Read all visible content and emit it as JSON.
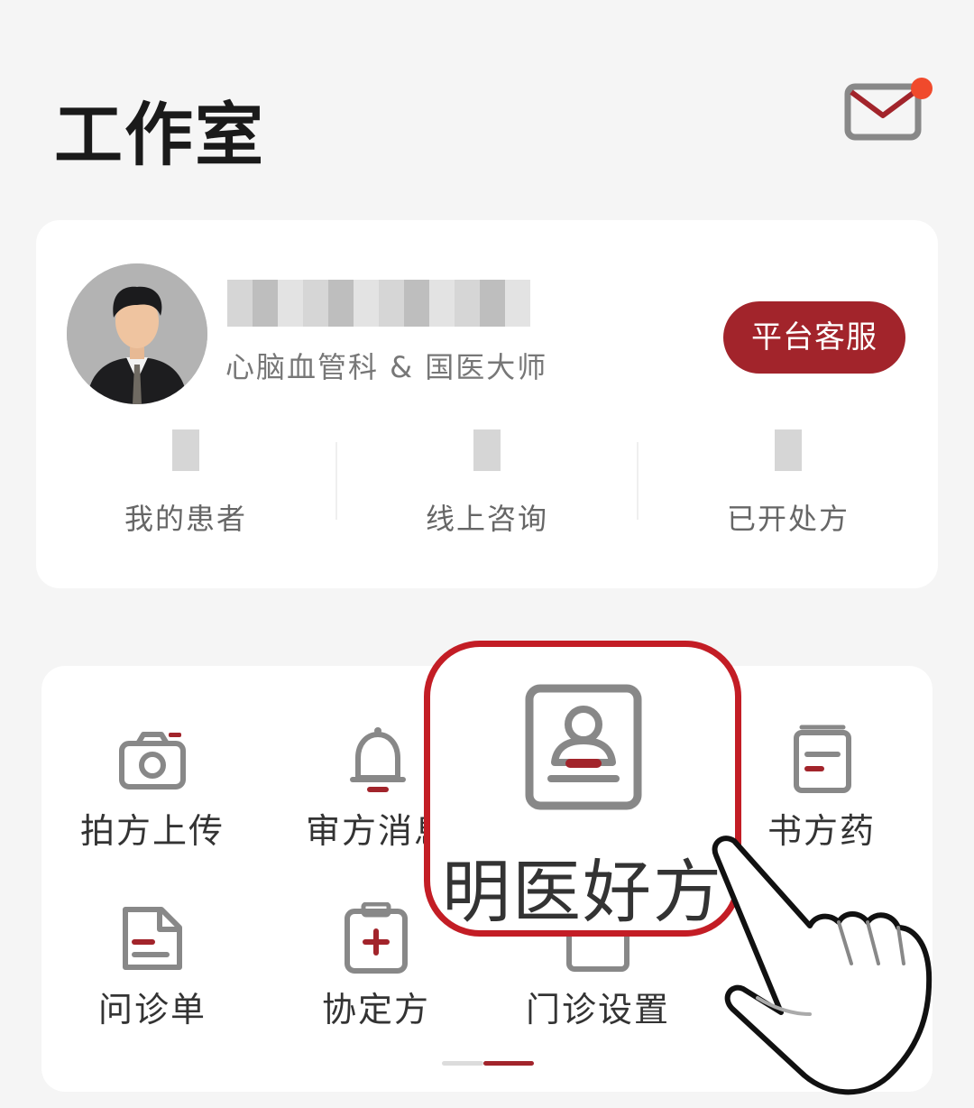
{
  "header": {
    "title": "工作室",
    "mail_icon": "mail-icon",
    "has_unread": true
  },
  "profile": {
    "name": "",
    "department": "心脑血管科 & 国医大师",
    "service_button": "平台客服",
    "stats": [
      {
        "value": "",
        "label": "我的患者"
      },
      {
        "value": "",
        "label": "线上咨询"
      },
      {
        "value": "",
        "label": "已开处方"
      }
    ]
  },
  "tools": [
    {
      "label": "拍方上传",
      "icon": "camera-icon"
    },
    {
      "label": "审方消息",
      "icon": "bell-icon"
    },
    {
      "label": "明医好方",
      "icon": "contact-card-icon"
    },
    {
      "label": "书方药",
      "icon": "notebook-icon"
    },
    {
      "label": "问诊单",
      "icon": "document-icon"
    },
    {
      "label": "协定方",
      "icon": "clipboard-plus-icon"
    },
    {
      "label": "门诊设置",
      "icon": "calendar-icon"
    }
  ],
  "highlight": {
    "label": "明医好方"
  },
  "colors": {
    "accent": "#a2242b",
    "highlight_border": "#c31d25",
    "notification_dot": "#f04a2c",
    "background": "#f5f5f5"
  }
}
